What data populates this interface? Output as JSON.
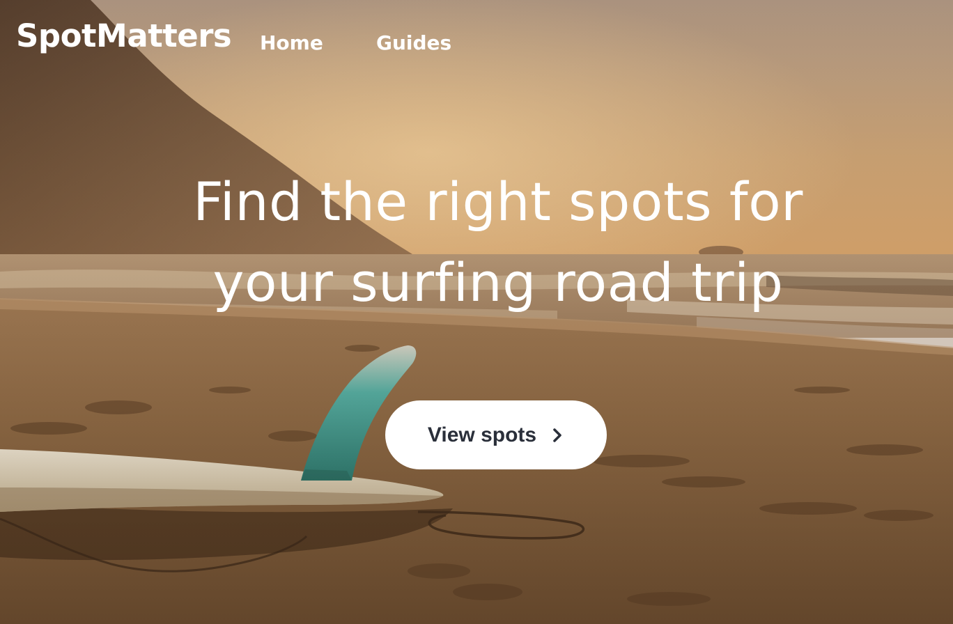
{
  "header": {
    "logo": "SpotMatters",
    "nav": [
      {
        "label": "Home"
      },
      {
        "label": "Guides"
      }
    ]
  },
  "hero": {
    "title_line1": "Find the right spots for",
    "title_line2": "your surfing road trip",
    "cta": {
      "label": "View spots",
      "icon": "chevron-right-icon"
    },
    "background": {
      "icon": "beach-surfboard-photo"
    }
  },
  "colors": {
    "text_light": "#ffffff",
    "button_bg": "#ffffff",
    "button_text": "#2a2f3a",
    "sky": "#c9a57d",
    "sand": "#8a6440"
  }
}
